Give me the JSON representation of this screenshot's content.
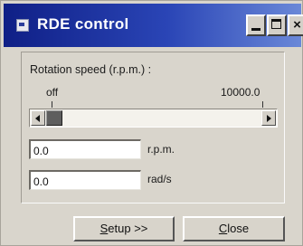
{
  "window": {
    "title": "RDE control",
    "min_glyph": "minimize-icon",
    "max_glyph": "maximize-icon",
    "close_glyph": "×"
  },
  "rotation": {
    "label": "Rotation speed (r.p.m.) :",
    "min_label": "off",
    "max_label": "10000.0",
    "slider_fraction": 0.0
  },
  "fields": [
    {
      "value": "0.0",
      "unit": "r.p.m."
    },
    {
      "value": "0.0",
      "unit": "rad/s"
    }
  ],
  "buttons": {
    "setup_mnemonic": "S",
    "setup_rest": "etup >>",
    "close_mnemonic": "C",
    "close_rest": "lose"
  },
  "colors": {
    "title_start": "#0f1f86",
    "title_end": "#6a88d8",
    "face": "#d9d5cc"
  }
}
